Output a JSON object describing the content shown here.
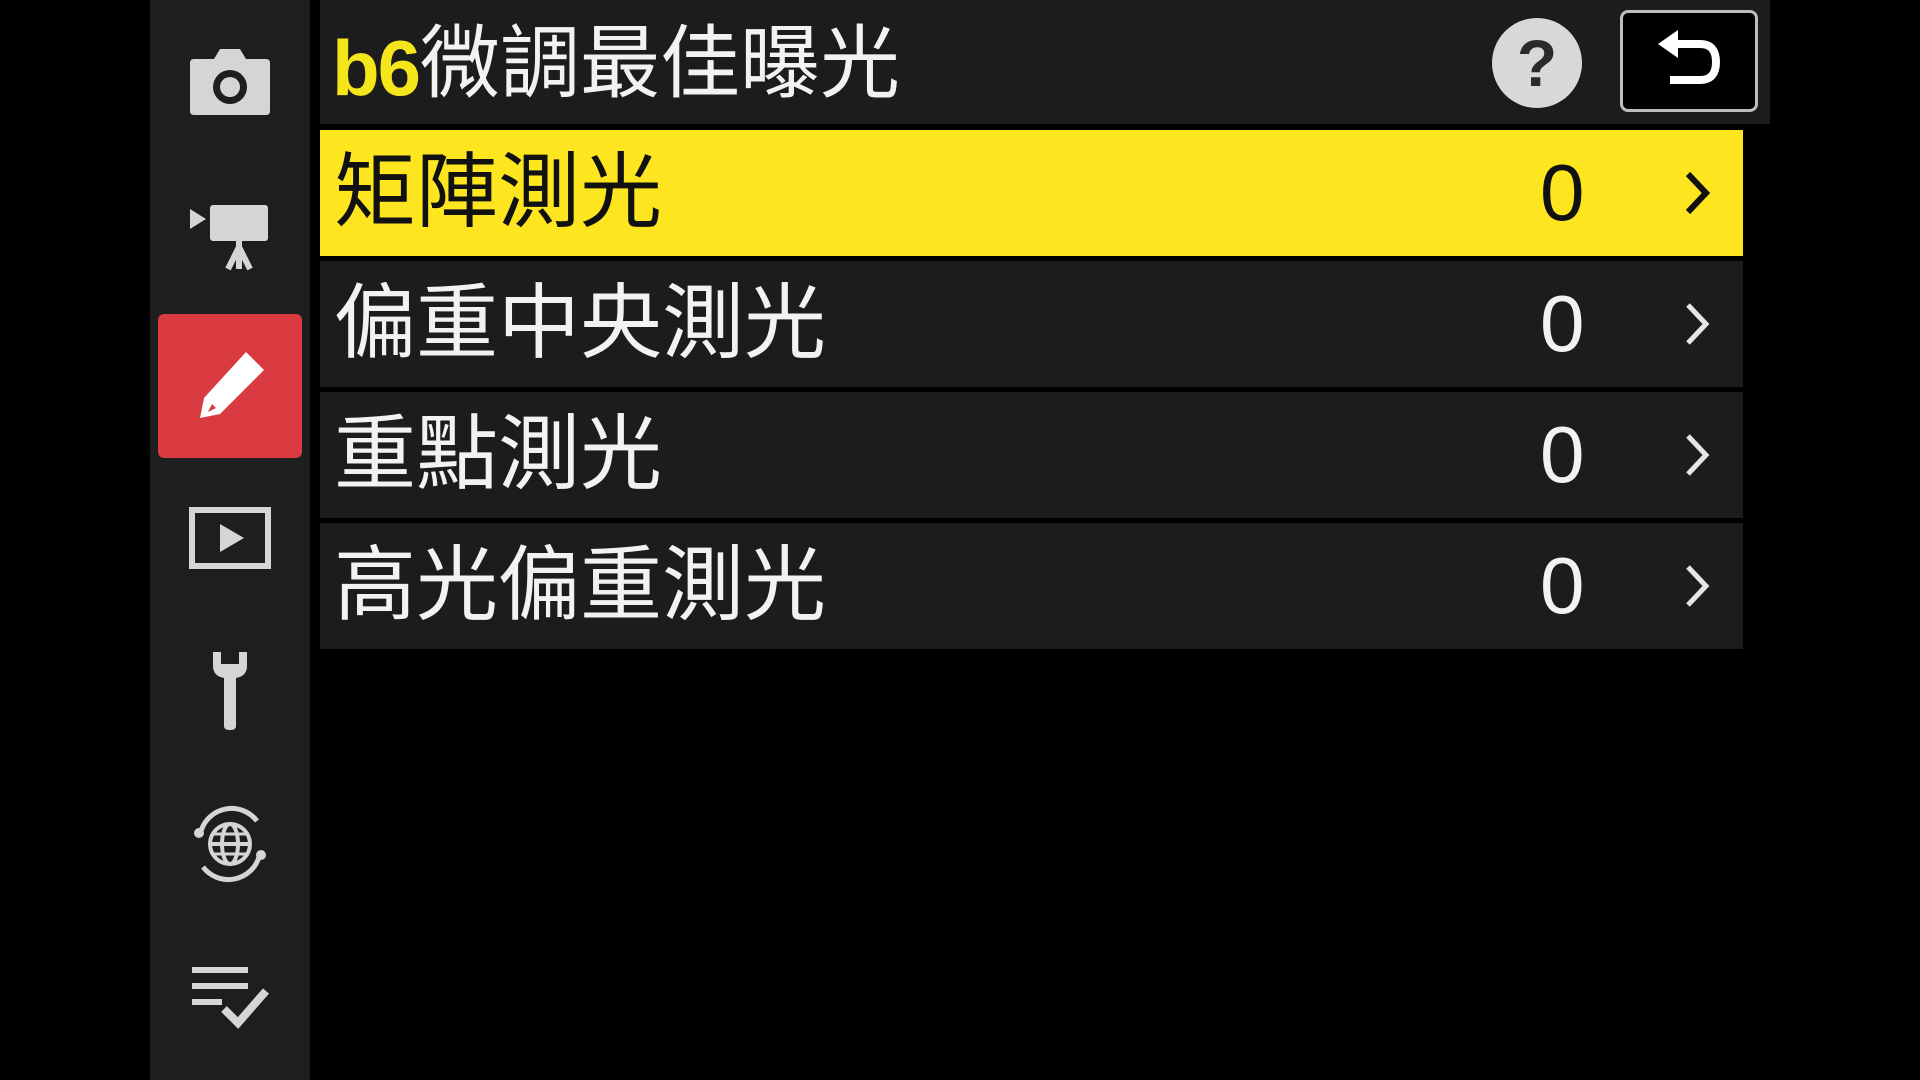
{
  "header": {
    "menu_code": "b6",
    "title": "微調最佳曝光",
    "help_label": "?"
  },
  "sidebar": {
    "tabs": [
      {
        "name": "photo-shooting-menu",
        "icon": "camera-icon",
        "active": false
      },
      {
        "name": "movie-recording-menu",
        "icon": "movie-camera-icon",
        "active": false
      },
      {
        "name": "custom-settings-menu",
        "icon": "pencil-icon",
        "active": true
      },
      {
        "name": "playback-menu",
        "icon": "playback-icon",
        "active": false
      },
      {
        "name": "setup-menu",
        "icon": "wrench-icon",
        "active": false
      },
      {
        "name": "network-menu",
        "icon": "network-globe-icon",
        "active": false
      },
      {
        "name": "my-menu",
        "icon": "my-menu-checklist-icon",
        "active": false
      }
    ]
  },
  "menu": {
    "items": [
      {
        "label": "矩陣測光",
        "value": "0",
        "selected": true
      },
      {
        "label": "偏重中央測光",
        "value": "0",
        "selected": false
      },
      {
        "label": "重點測光",
        "value": "0",
        "selected": false
      },
      {
        "label": "高光偏重測光",
        "value": "0",
        "selected": false
      }
    ]
  },
  "colors": {
    "selected_row": "#fde620",
    "active_tab": "#d83a3f",
    "menu_code": "#f5e61c",
    "row_background": "#1c1c1c"
  }
}
